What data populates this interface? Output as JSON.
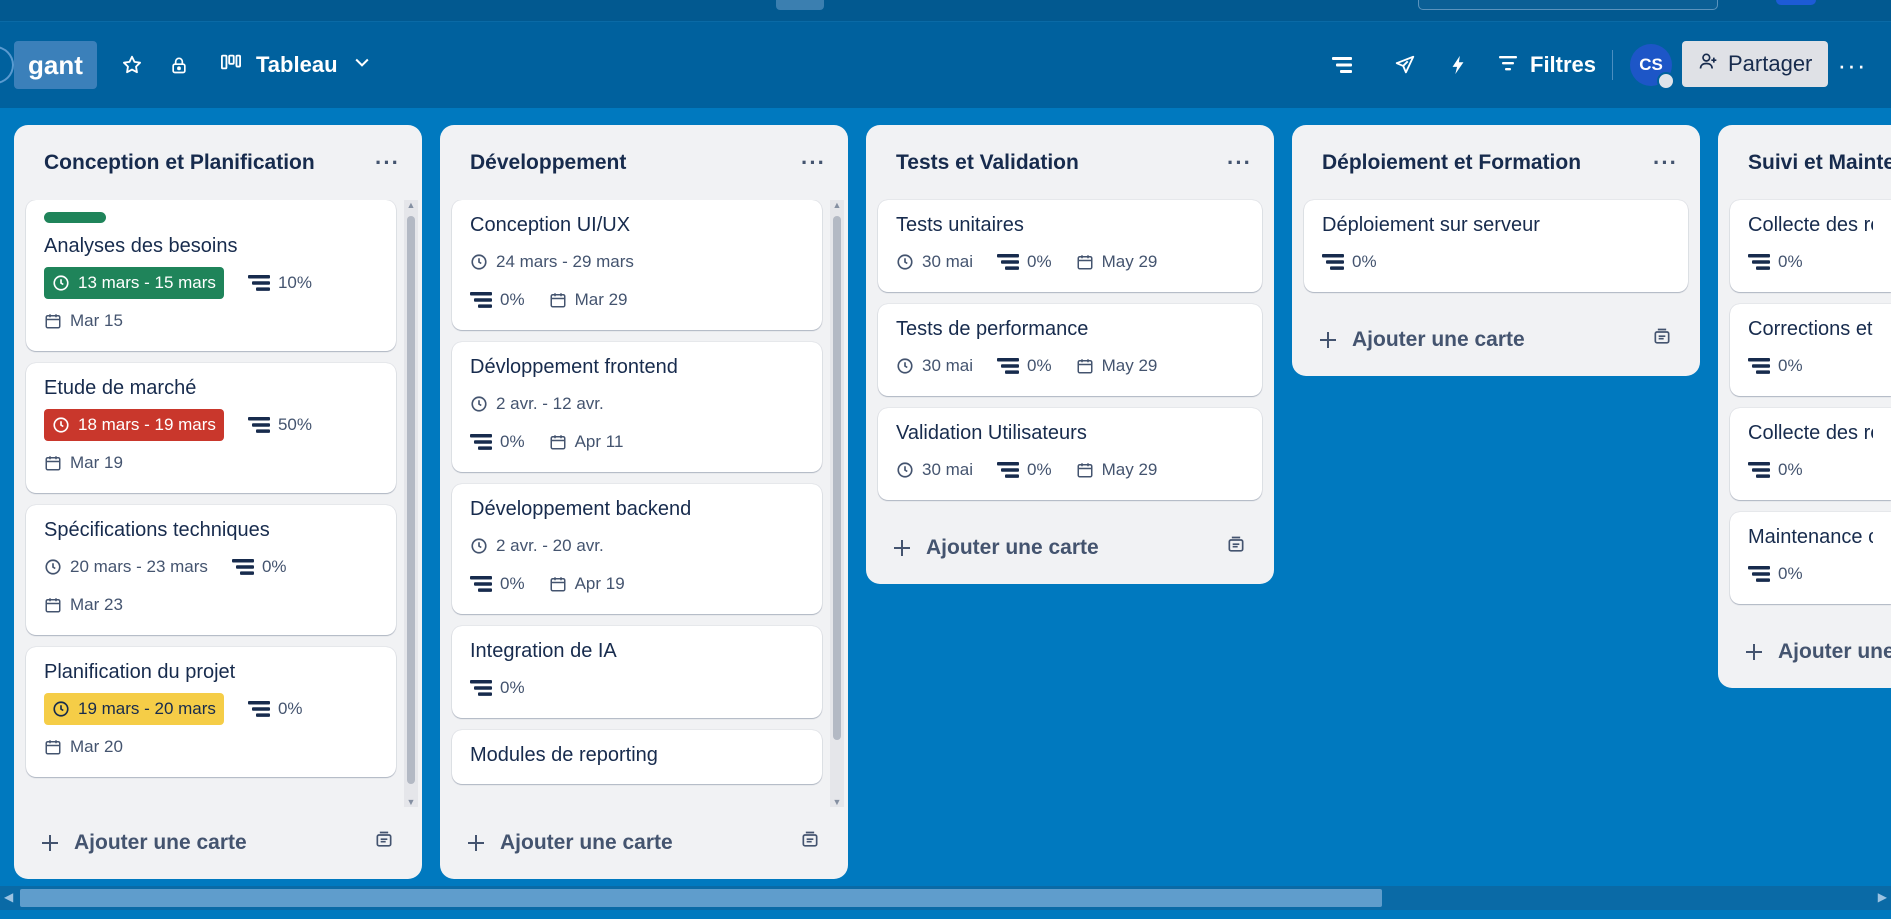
{
  "board": {
    "name": "gant",
    "view_label": "Tableau",
    "filters_label": "Filtres",
    "avatar_initials": "CS",
    "share_label": "Partager",
    "more_label": "···",
    "background_color": "#0079bf",
    "header_color": "#00619e"
  },
  "lists": [
    {
      "title": "Conception et Planification",
      "menu": "···",
      "add_label": "Ajouter une carte",
      "cards": [
        {
          "has_label": true,
          "label_color": "#1f845a",
          "title": "Analyses des besoins",
          "dates": "13 mars - 15 mars",
          "date_style": "green",
          "progress": "10%",
          "due": "Mar 15"
        },
        {
          "title": "Etude de marché",
          "dates": "18 mars - 19 mars",
          "date_style": "red",
          "progress": "50%",
          "due": "Mar 19"
        },
        {
          "title": "Spécifications techniques",
          "dates": "20 mars - 23 mars",
          "date_style": "plain",
          "progress": "0%",
          "due": "Mar 23"
        },
        {
          "title": "Planification du projet",
          "dates": "19 mars - 20 mars",
          "date_style": "yellow",
          "progress": "0%",
          "due": "Mar 20"
        }
      ]
    },
    {
      "title": "Développement",
      "menu": "···",
      "add_label": "Ajouter une carte",
      "cards": [
        {
          "title": "Conception UI/UX",
          "dates": "24 mars - 29 mars",
          "date_style": "plain",
          "progress": "0%",
          "due": "Mar 29"
        },
        {
          "title": "Dévloppement frontend",
          "dates": "2 avr. - 12 avr.",
          "date_style": "plain",
          "progress": "0%",
          "due": "Apr 11"
        },
        {
          "title": "Développement backend",
          "dates": "2 avr. - 20 avr.",
          "date_style": "plain",
          "progress": "0%",
          "due": "Apr 19"
        },
        {
          "title": "Integration de IA",
          "progress": "0%"
        },
        {
          "title": "Modules de reporting"
        }
      ]
    },
    {
      "title": "Tests et Validation",
      "menu": "···",
      "add_label": "Ajouter une carte",
      "cards": [
        {
          "title": "Tests unitaires",
          "dates": "30 mai",
          "date_style": "plain",
          "progress": "0%",
          "due": "May 29"
        },
        {
          "title": "Tests de performance",
          "dates": "30 mai",
          "date_style": "plain",
          "progress": "0%",
          "due": "May 29"
        },
        {
          "title": "Validation Utilisateurs",
          "dates": "30 mai",
          "date_style": "plain",
          "progress": "0%",
          "due": "May 29"
        }
      ]
    },
    {
      "title": "Déploiement et Formation",
      "menu": "···",
      "add_label": "Ajouter une carte",
      "cards": [
        {
          "title": "Déploiement sur serveur",
          "progress": "0%"
        }
      ]
    },
    {
      "title": "Suivi et Mainte",
      "menu": "",
      "add_label": "Ajouter une",
      "cards": [
        {
          "title": "Collecte des ret",
          "progress": "0%"
        },
        {
          "title": "Corrections et a",
          "progress": "0%"
        },
        {
          "title": "Collecte des ret",
          "progress": "0%"
        },
        {
          "title": "Maintenance co",
          "progress": "0%"
        }
      ]
    }
  ]
}
